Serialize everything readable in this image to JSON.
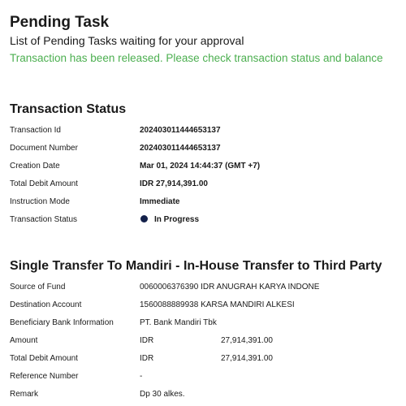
{
  "header": {
    "title": "Pending Task",
    "subtitle": "List of Pending Tasks waiting for your approval",
    "success_message": "Transaction has been released. Please check transaction status and balance"
  },
  "transaction_status": {
    "title": "Transaction Status",
    "rows": {
      "transaction_id": {
        "label": "Transaction Id",
        "value": "202403011444653137"
      },
      "document_number": {
        "label": "Document Number",
        "value": "202403011444653137"
      },
      "creation_date": {
        "label": "Creation Date",
        "value": "Mar 01, 2024 14:44:37 (GMT +7)"
      },
      "total_debit_amount": {
        "label": "Total Debit Amount",
        "value": "IDR 27,914,391.00"
      },
      "instruction_mode": {
        "label": "Instruction Mode",
        "value": "Immediate"
      },
      "transaction_status": {
        "label": "Transaction Status",
        "value": "In Progress"
      }
    },
    "status_color": "#13204a"
  },
  "transfer": {
    "title": "Single Transfer To Mandiri - In-House Transfer to Third Party",
    "rows": {
      "source_of_fund": {
        "label": "Source of Fund",
        "value": "0060006376390 IDR ANUGRAH KARYA INDONE"
      },
      "destination_account": {
        "label": "Destination Account",
        "value": "1560088889938 KARSA MANDIRI ALKESI"
      },
      "beneficiary_bank": {
        "label": "Beneficiary Bank Information",
        "value": "PT. Bank Mandiri Tbk"
      },
      "amount": {
        "label": "Amount",
        "currency": "IDR",
        "value": "27,914,391.00"
      },
      "total_debit_amount": {
        "label": "Total Debit Amount",
        "currency": "IDR",
        "value": "27,914,391.00"
      },
      "reference_number": {
        "label": "Reference Number",
        "value": "-"
      },
      "remark": {
        "label": "Remark",
        "value": "Dp 30 alkes."
      }
    }
  },
  "colors": {
    "success": "#4caf50",
    "text": "#1a1a1a"
  }
}
